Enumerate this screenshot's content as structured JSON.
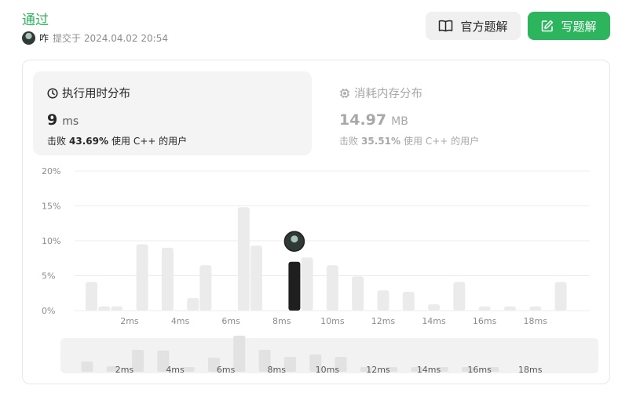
{
  "submission": {
    "status": "通过",
    "user": "咋",
    "submitted_label": "提交于",
    "timestamp": "2024.04.02 20:54"
  },
  "buttons": {
    "official_solution": "官方题解",
    "write_solution": "写题解"
  },
  "tabs": {
    "runtime": {
      "title": "执行用时分布",
      "value": "9",
      "unit": "ms",
      "beats_label": "击败",
      "beats_pct": "43.69%",
      "lang_text": "使用 C++ 的用户"
    },
    "memory": {
      "title": "消耗内存分布",
      "value": "14.97",
      "unit": "MB",
      "beats_label": "击败",
      "beats_pct": "35.51%",
      "lang_text": "使用 C++ 的用户"
    }
  },
  "colors": {
    "accent_green": "#2db55d",
    "bar": "#ebebeb",
    "highlight_bar": "#1f1f1f"
  },
  "chart_data": {
    "type": "bar",
    "y_ticks": [
      "20%",
      "15%",
      "10%",
      "5%",
      "0%"
    ],
    "ylim": [
      0,
      20
    ],
    "x_ticks": [
      "2ms",
      "4ms",
      "6ms",
      "8ms",
      "10ms",
      "12ms",
      "14ms",
      "16ms",
      "18ms"
    ],
    "x": [
      0.5,
      1,
      1.5,
      2.5,
      3.5,
      4.5,
      5,
      6.5,
      7,
      8.5,
      9,
      10,
      11,
      12,
      13,
      14,
      15,
      16,
      17,
      18,
      19
    ],
    "values": [
      4.1,
      0.6,
      0.6,
      9.5,
      9.0,
      1.8,
      6.5,
      14.8,
      9.3,
      7.0,
      7.6,
      6.5,
      4.9,
      2.9,
      2.7,
      0.9,
      4.1,
      0.6,
      0.6,
      0.6,
      4.1
    ],
    "highlight_value": 7.0,
    "grid": true,
    "overview_values": [
      1.3,
      0.7,
      2.8,
      2.7,
      0.6,
      1.8,
      4.6,
      2.8,
      1.9,
      2.2,
      1.9,
      0.6,
      0.6,
      0.6,
      0.6,
      0.6,
      0.6
    ]
  }
}
